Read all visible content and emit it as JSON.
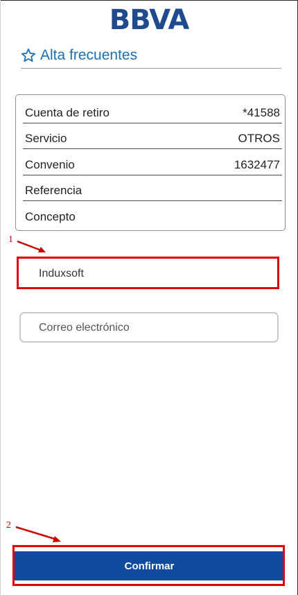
{
  "app": {
    "logo": "BBVA"
  },
  "header": {
    "title": "Alta frecuentes",
    "icon": "star-icon"
  },
  "details": {
    "rows": [
      {
        "label": "Cuenta de retiro",
        "value": "*41588"
      },
      {
        "label": "Servicio",
        "value": "OTROS"
      },
      {
        "label": "Convenio",
        "value": "1632477"
      },
      {
        "label": "Referencia",
        "value": ""
      },
      {
        "label": "Concepto",
        "value": ""
      }
    ]
  },
  "form": {
    "name_value": "Induxsoft",
    "email_placeholder": "Correo electrónico"
  },
  "annotations": {
    "step1": "1",
    "step2": "2"
  },
  "actions": {
    "confirm_label": "Confirmar"
  },
  "colors": {
    "brand": "#1f4b8e",
    "accent": "#1b6fb4",
    "button": "#0f4a9c",
    "highlight": "#e00000"
  }
}
